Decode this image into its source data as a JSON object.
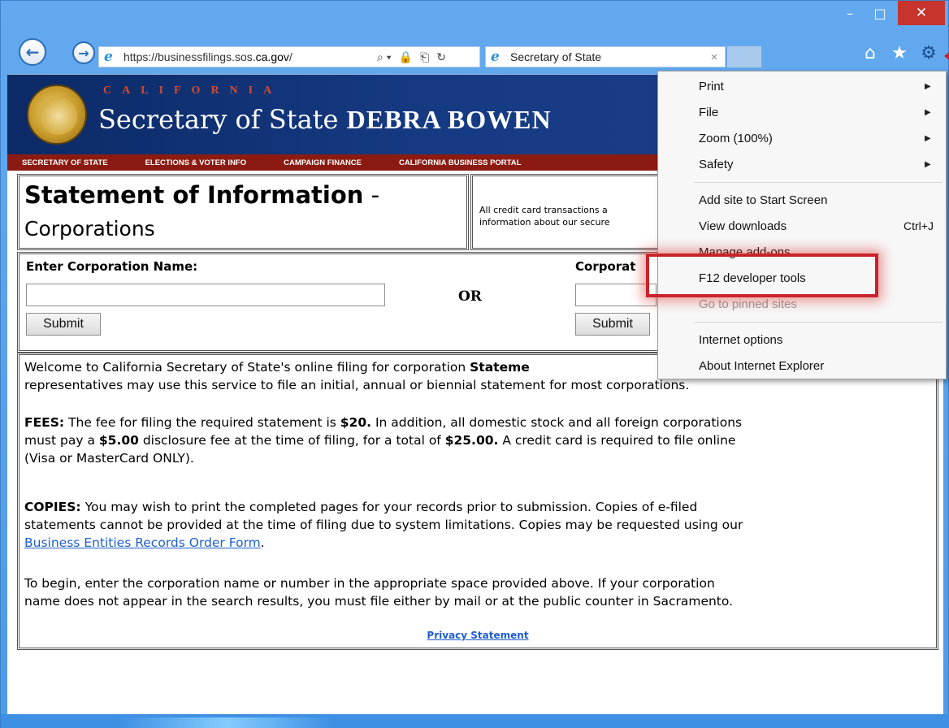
{
  "window": {
    "minimize_glyph": "–",
    "maximize_glyph": "□",
    "close_glyph": "✕"
  },
  "nav": {
    "back_glyph": "←",
    "forward_glyph": "→",
    "address_prefix": "https://businessfilings.sos.",
    "address_domain": "ca.gov",
    "address_suffix": "/",
    "address_tools": [
      "⌕ ▾",
      "🔒",
      "⎗",
      "↻"
    ],
    "tab_title": "Secretary of State",
    "tab_close": "×",
    "home_icon": "⌂",
    "favorites_icon": "★",
    "tools_icon": "⚙"
  },
  "banner": {
    "letters": "CALIFORNIA",
    "title_prefix": "Secretary of State ",
    "title_name": "DEBRA BOWEN",
    "menu": [
      "SECRETARY OF STATE",
      "ELECTIONS & VOTER INFO",
      "CAMPAIGN FINANCE",
      "CALIFORNIA BUSINESS PORTAL"
    ]
  },
  "heading": {
    "title": "Statement of Information",
    "dash": " -",
    "subtitle": "Corporations",
    "notice_line1": "All credit card transactions a",
    "notice_line2": "information about our secure"
  },
  "search": {
    "name_label": "Enter Corporation Name:",
    "name_value": "",
    "or_label": "OR",
    "number_label": "Corporat",
    "number_value": "",
    "submit_label": "Submit"
  },
  "body": {
    "welcome": {
      "text1": "Welcome to California Secretary of State's online filing for corporation ",
      "bold1": "Stateme",
      "text2": "representatives may use this service to file an initial, annual or biennial statement for most corporations."
    },
    "fees": {
      "label": "FEES:",
      "t1": " The fee for filing the required statement is ",
      "b1": "$20.",
      "t2": " In addition, all domestic stock and all foreign corporations",
      "t3": "must pay a ",
      "b2": "$5.00",
      "t4": " disclosure fee at the time of filing, for a total of ",
      "b3": "$25.00.",
      "t5": " A credit card is required to file online",
      "t6": "(Visa or MasterCard ONLY)."
    },
    "copies": {
      "label": "COPIES:",
      "t1": " You may wish to print the completed pages for your records prior to submission. Copies of e-filed",
      "t2": "statements cannot be provided at the time of filing due to system limitations. Copies may be requested using our",
      "link": "Business Entities Records Order Form",
      "t3": "."
    },
    "begin": {
      "t1": "To begin, enter the corporation name or number in the appropriate space provided above. If your corporation",
      "t2": "name does not appear in the search results, you must file either by mail or at the public counter in Sacramento."
    },
    "privacy": "Privacy Statement"
  },
  "menu": {
    "items": [
      {
        "label": "Print",
        "arrow": "▶",
        "shortcut": "",
        "disabled": false
      },
      {
        "label": "File",
        "arrow": "▶",
        "shortcut": "",
        "disabled": false
      },
      {
        "label": "Zoom (100%)",
        "arrow": "▶",
        "shortcut": "",
        "disabled": false
      },
      {
        "label": "Safety",
        "arrow": "▶",
        "shortcut": "",
        "disabled": false
      },
      {
        "label": "Add site to Start Screen",
        "arrow": "",
        "shortcut": "",
        "disabled": false
      },
      {
        "label": "View downloads",
        "arrow": "",
        "shortcut": "Ctrl+J",
        "disabled": false
      },
      {
        "label": "Manage add-ons",
        "arrow": "",
        "shortcut": "",
        "disabled": false
      },
      {
        "label": "F12 developer tools",
        "arrow": "",
        "shortcut": "",
        "disabled": false
      },
      {
        "label": "Go to pinned sites",
        "arrow": "",
        "shortcut": "",
        "disabled": true
      },
      {
        "label": "Internet options",
        "arrow": "",
        "shortcut": "",
        "disabled": false
      },
      {
        "label": "About Internet Explorer",
        "arrow": "",
        "shortcut": "",
        "disabled": false
      }
    ]
  },
  "colors": {
    "highlight": "#c9222a",
    "banner": "#163a82",
    "menubar": "#8b1b12",
    "link": "#1f5fcc"
  }
}
